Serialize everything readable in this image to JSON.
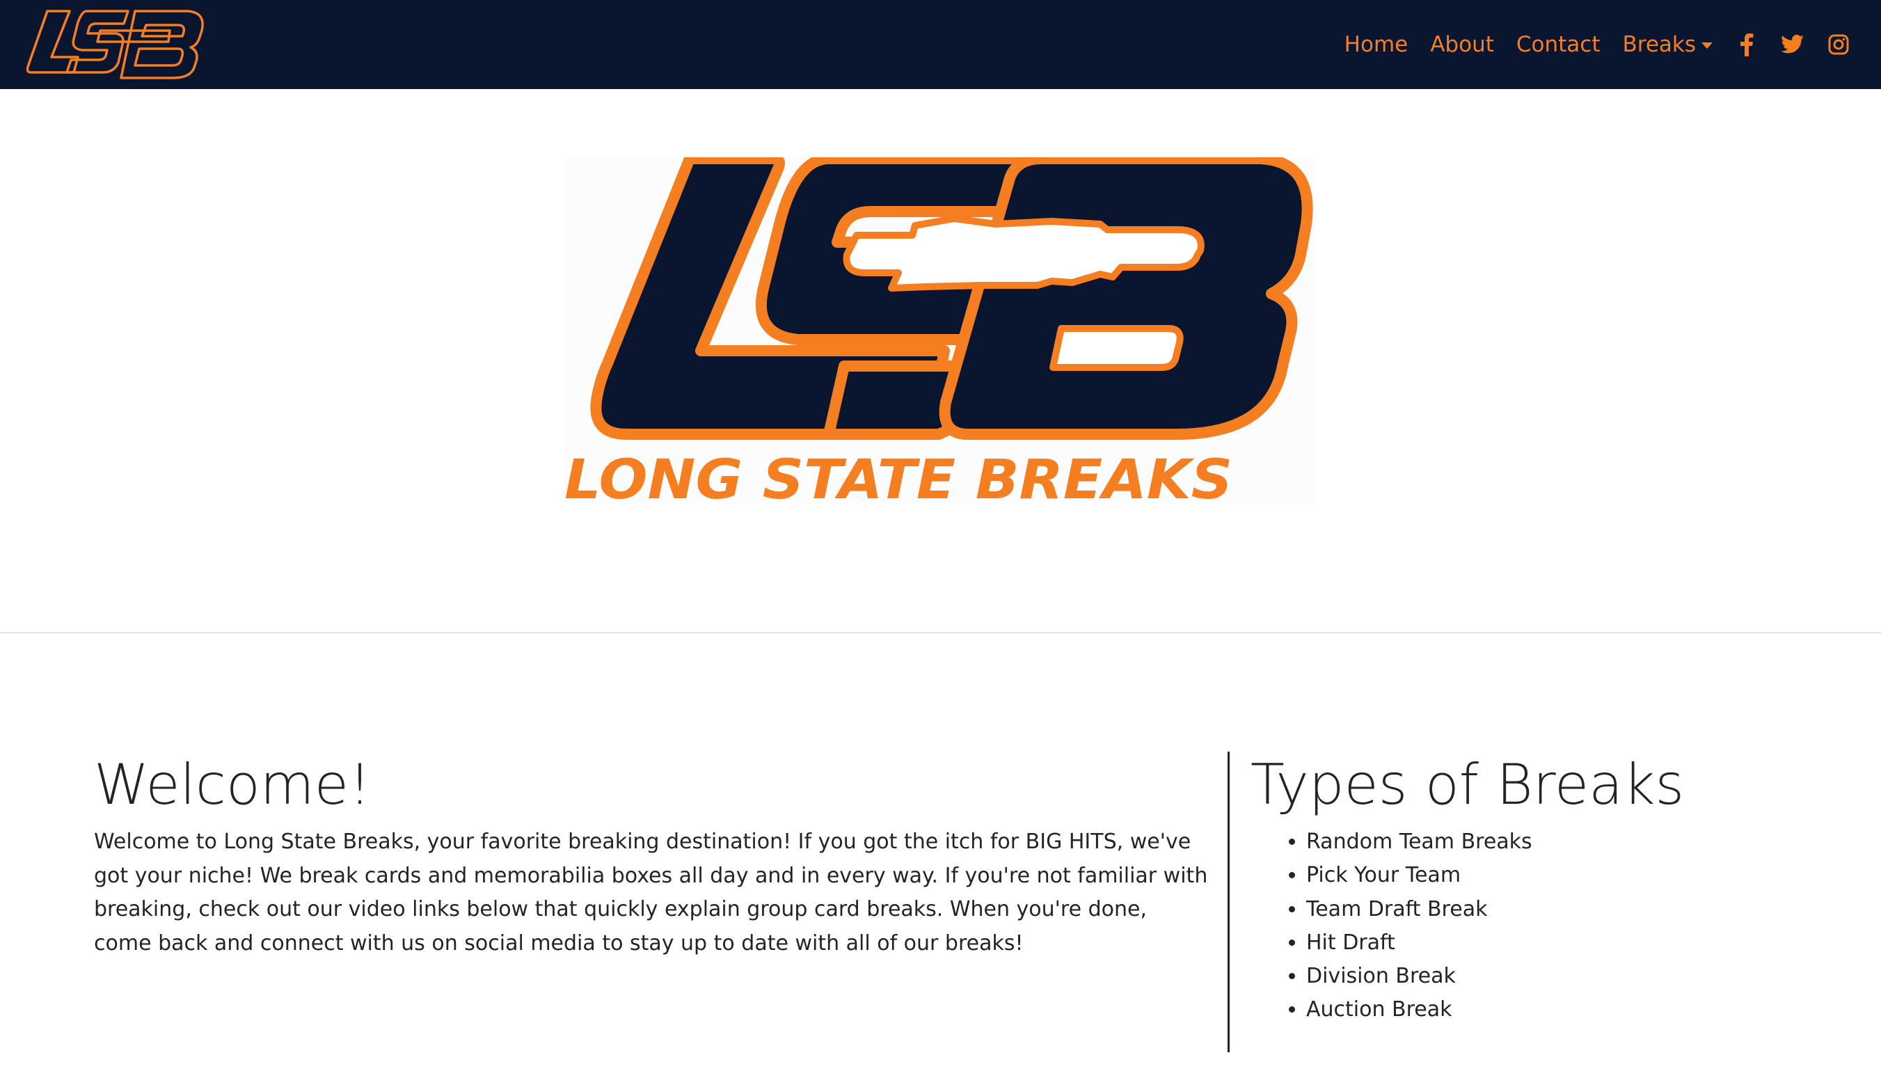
{
  "colors": {
    "nav_bg": "#0a1630",
    "accent": "#f57e20",
    "text": "#212529"
  },
  "navbar": {
    "logo_text": "LSB",
    "links": [
      {
        "label": "Home"
      },
      {
        "label": "About"
      },
      {
        "label": "Contact"
      },
      {
        "label": "Breaks",
        "has_dropdown": true
      }
    ],
    "social_icons": [
      "facebook-icon",
      "twitter-icon",
      "instagram-icon"
    ]
  },
  "hero": {
    "logo_letters": "LSB",
    "logo_wordmark": "LONG STATE BREAKS"
  },
  "welcome": {
    "heading": "Welcome!",
    "body": "Welcome to Long State Breaks, your favorite breaking destination! If you got the itch for BIG HITS, we've got your niche! We break cards and memorabilia boxes all day and in every way. If you're not familiar with breaking, check out our video links below that quickly explain group card breaks. When you're done, come back and connect with us on social media to stay up to date with all of our breaks!"
  },
  "types": {
    "heading": "Types of Breaks",
    "items": [
      "Random Team Breaks",
      "Pick Your Team",
      "Team Draft Break",
      "Hit Draft",
      "Division Break",
      "Auction Break"
    ]
  }
}
